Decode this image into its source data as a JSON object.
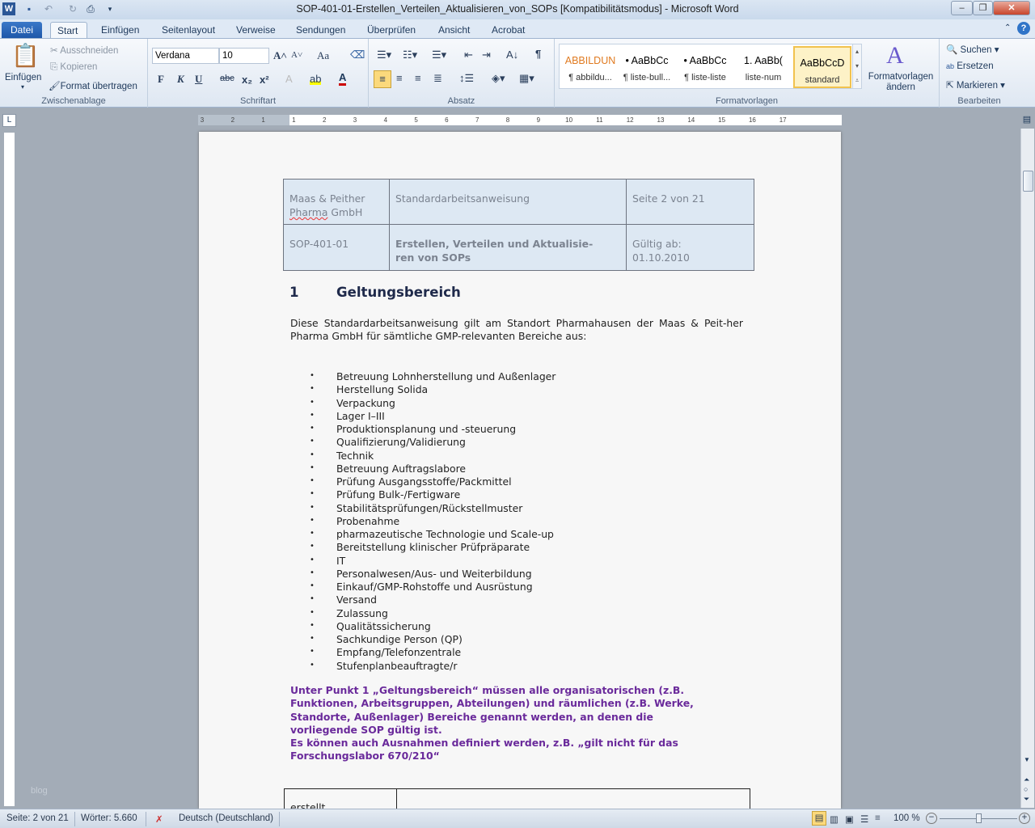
{
  "window": {
    "title": "SOP-401-01-Erstellen_Verteilen_Aktualisieren_von_SOPs [Kompatibilitätsmodus] - Microsoft Word"
  },
  "tabs": [
    "Datei",
    "Start",
    "Einfügen",
    "Seitenlayout",
    "Verweise",
    "Sendungen",
    "Überprüfen",
    "Ansicht",
    "Acrobat"
  ],
  "clipboard": {
    "paste": "Einfügen",
    "cut": "Ausschneiden",
    "copy": "Kopieren",
    "format_painter": "Format übertragen",
    "label": "Zwischenablage"
  },
  "font": {
    "name": "Verdana",
    "size": "10",
    "label": "Schriftart",
    "bold": "F",
    "italic": "K",
    "underline": "U",
    "strike": "abc",
    "sub": "x₂",
    "sup": "x²",
    "case": "Aa"
  },
  "paragraph": {
    "label": "Absatz",
    "pilcrow": "¶"
  },
  "styles": {
    "label": "Formatvorlagen",
    "items": [
      {
        "preview": "ABBILDUN",
        "name": "¶ abbildu..."
      },
      {
        "preview": "• AaBbCc",
        "name": "¶ liste-bull..."
      },
      {
        "preview": "• AaBbCc",
        "name": "¶ liste-liste"
      },
      {
        "preview": "1.  AaBb(",
        "name": "liste-num"
      },
      {
        "preview": "AaBbCcD",
        "name": "standard"
      }
    ],
    "change": "Formatvorlagen ändern"
  },
  "editing": {
    "label": "Bearbeiten",
    "find": "Suchen",
    "replace": "Ersetzen",
    "select": "Markieren"
  },
  "ruler": [
    "3",
    "2",
    "1",
    "1",
    "2",
    "3",
    "4",
    "5",
    "6",
    "7",
    "8",
    "9",
    "10",
    "11",
    "12",
    "13",
    "14",
    "15",
    "16",
    "17"
  ],
  "doc": {
    "header": {
      "company": "Maas & Peither ",
      "company2": "Pharma",
      "company3": " GmbH",
      "type": "Standardarbeitsanweisung",
      "page": "Seite 2 von 21",
      "id": "SOP-401-01",
      "title": "Erstellen, Verteilen und Aktualisie-ren von SOPs",
      "valid": "Gültig ab: 01.10.2010"
    },
    "heading_num": "1",
    "heading": "Geltungsbereich",
    "intro": "Diese Standardarbeitsanweisung gilt am Standort Pharmahausen der Maas & Peit-her Pharma GmbH für sämtliche GMP-relevanten Bereiche aus:",
    "bullets": [
      "Betreuung Lohnherstellung und Außenlager",
      "Herstellung Solida",
      "Verpackung",
      "Lager I–III",
      "Produktionsplanung und -steuerung",
      "Qualifizierung/Validierung",
      "Technik",
      "Betreuung Auftragslabore",
      "Prüfung Ausgangsstoffe/Packmittel",
      "Prüfung Bulk-/Fertigware",
      "Stabilitätsprüfungen/Rückstellmuster",
      "Probenahme",
      "pharmazeutische Technologie und Scale-up",
      "Bereitstellung klinischer Prüfpräparate",
      "IT",
      "Personalwesen/Aus- und Weiterbildung",
      "Einkauf/GMP-Rohstoffe und Ausrüstung",
      "Versand",
      "Zulassung",
      "Qualitätssicherung",
      "Sachkundige Person (QP)",
      "Empfang/Telefonzentrale",
      "Stufenplanbeauftragte/r"
    ],
    "note": [
      "Unter Punkt 1 „Geltungsbereich“ müssen alle organisatorischen (z.B.",
      "Funktionen, Arbeitsgruppen, Abteilungen) und räumlichen (z.B. Werke,",
      "Standorte, Außenlager) Bereiche genannt werden, an denen die",
      "vorliegende SOP gültig ist.",
      "Es können auch Ausnahmen definiert werden, z.B. „gilt nicht für das",
      "Forschungslabor 670/210“"
    ],
    "footer_cell": "erstellt"
  },
  "watermark": "blog",
  "status": {
    "page": "Seite: 2 von 21",
    "words": "Wörter: 5.660",
    "language": "Deutsch (Deutschland)",
    "zoom": "100 %",
    "zoom_percent": 100
  }
}
